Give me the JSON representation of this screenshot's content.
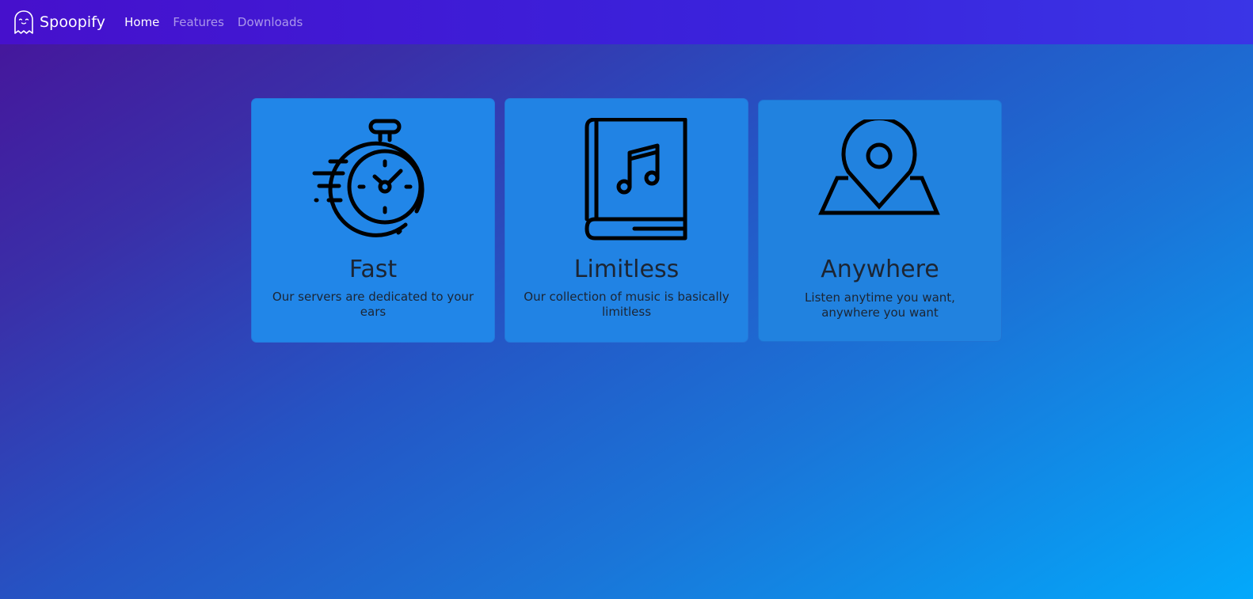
{
  "navbar": {
    "brand": "Spoopify",
    "links": [
      {
        "label": "Home",
        "active": true
      },
      {
        "label": "Features",
        "active": false
      },
      {
        "label": "Downloads",
        "active": false
      }
    ]
  },
  "features": [
    {
      "title": "Fast",
      "description": "Our servers are dedicated to your ears",
      "icon": "stopwatch-icon"
    },
    {
      "title": "Limitless",
      "description": "Our collection of music is basically limitless",
      "icon": "music-book-icon"
    },
    {
      "title": "Anywhere",
      "description": "Listen anytime you want, anywhere you want",
      "icon": "map-pin-icon"
    }
  ],
  "colors": {
    "navbar": "#3f1ad6",
    "card": "#2186e8",
    "text": "#1c2533"
  }
}
